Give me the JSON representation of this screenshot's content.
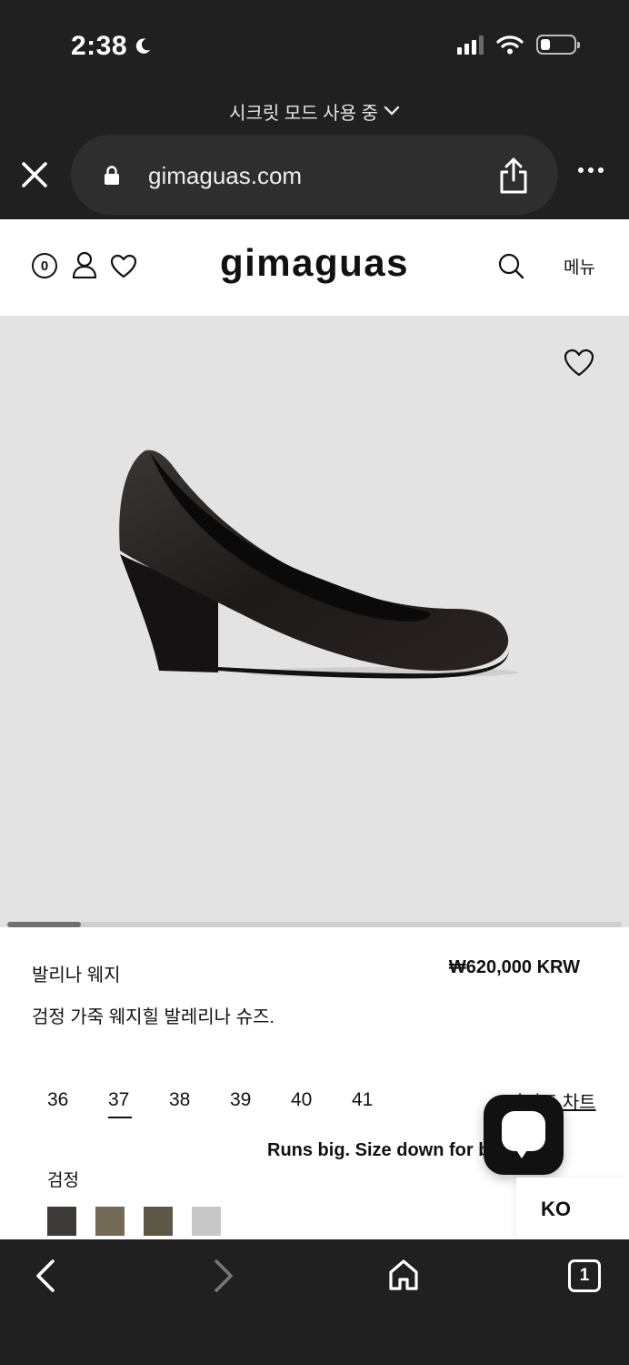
{
  "status_bar": {
    "time": "2:38"
  },
  "browser": {
    "mode_label": "시크릿 모드 사용 중",
    "url": "gimaguas.com",
    "tab_count": "1"
  },
  "header": {
    "cart_count": "0",
    "logo": "gimaguas",
    "menu_label": "메뉴"
  },
  "product": {
    "name": "발리나 웨지",
    "price": "₩620,000 KRW",
    "description": "검정 가죽 웨지힐 발레리나 슈즈.",
    "sizes": [
      "36",
      "37",
      "38",
      "39",
      "40",
      "41"
    ],
    "selected_size": "37",
    "size_chart_label": "사이즈 차트",
    "fit_note": "Runs big. Size down for best fit.",
    "color_label": "검정",
    "swatch_colors": [
      "#3e3a38",
      "#736a56",
      "#5d5745",
      "#c7c7c7"
    ],
    "image_scroll_fraction": 0.12
  },
  "widgets": {
    "language": "KO"
  },
  "colors": {
    "chrome_bg": "#202020",
    "image_bg": "#e3e3e3",
    "text": "#111111"
  }
}
